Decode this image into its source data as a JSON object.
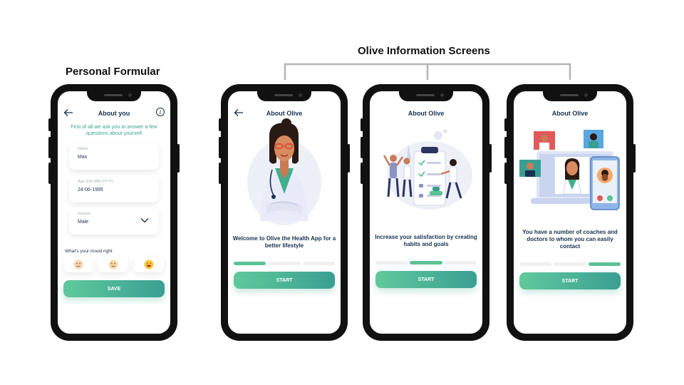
{
  "headings": {
    "personal": "Personal Formular",
    "olive": "Olive Information Screens"
  },
  "colors": {
    "accent": "#5cc295",
    "accent_dark": "#3a9f93",
    "title": "#17324f",
    "intro_text": "#3aa58a"
  },
  "form_screen": {
    "title": "About you",
    "back_icon": "back-arrow-icon",
    "info_icon_glyph": "i",
    "intro": "First of all we ask you to answer a few questions about yourself",
    "fields": [
      {
        "label": "Name",
        "value": "Max"
      },
      {
        "label": "Age (DD-MM-YYYY)",
        "value": "24-06-1995"
      },
      {
        "label": "Gender",
        "value": "Male"
      }
    ],
    "mood_label": "What's your mood right",
    "moods": [
      "sad-face-icon",
      "neutral-face-icon",
      "laughing-face-icon"
    ],
    "save_label": "SAVE"
  },
  "info_screens": [
    {
      "title": "About Olive",
      "caption": "Welcome to Olive the Health App for a better lifestyle",
      "button": "START",
      "progress_step": 1,
      "progress_total": 3
    },
    {
      "title": "About Olive",
      "caption": "Increase your satisfaction by creating habits and goals",
      "button": "START",
      "progress_step": 2,
      "progress_total": 3
    },
    {
      "title": "About Olive",
      "caption": "You have a number of coaches and doctors to whom you can easily contact",
      "button": "START",
      "progress_step": 3,
      "progress_total": 3
    }
  ]
}
